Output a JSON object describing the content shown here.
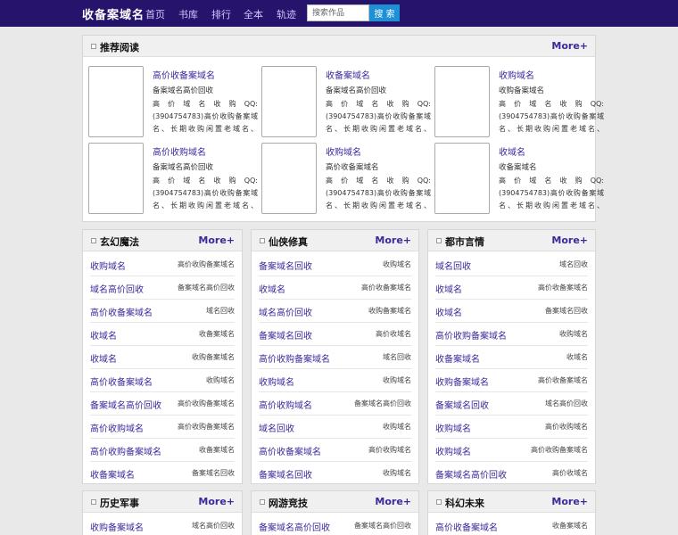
{
  "header": {
    "logo": "收备案域名",
    "nav": [
      "首页",
      "书库",
      "排行",
      "全本",
      "轨迹"
    ],
    "search_placeholder": "搜索作品",
    "search_button": "搜 索"
  },
  "featured": {
    "title": "推荐阅读",
    "more": "More+",
    "items": [
      {
        "title": "高价收备案域名",
        "author": "备案域名高价回收",
        "desc": "高价域名收购QQ:(3904754783)高价收购备案域名、长期收购闲置老域名、"
      },
      {
        "title": "收备案域名",
        "author": "备案域名高价回收",
        "desc": "高价域名收购QQ:(3904754783)高价收购备案域名、长期收购闲置老域名、"
      },
      {
        "title": "收购域名",
        "author": "收购备案域名",
        "desc": "高价域名收购QQ:(3904754783)高价收购备案域名、长期收购闲置老域名、"
      },
      {
        "title": "高价收购域名",
        "author": "备案域名高价回收",
        "desc": "高价域名收购QQ:(3904754783)高价收购备案域名、长期收购闲置老域名、"
      },
      {
        "title": "收购域名",
        "author": "高价收备案域名",
        "desc": "高价域名收购QQ:(3904754783)高价收购备案域名、长期收购闲置老域名、"
      },
      {
        "title": "收域名",
        "author": "收备案域名",
        "desc": "高价域名收购QQ:(3904754783)高价收购备案域名、长期收购闲置老域名、"
      }
    ]
  },
  "categories": [
    {
      "title": "玄幻魔法",
      "more": "More+",
      "rows": [
        {
          "title": "收购域名",
          "author": "高价收购备案域名"
        },
        {
          "title": "域名高价回收",
          "author": "备案域名高价回收"
        },
        {
          "title": "高价收备案域名",
          "author": "域名回收"
        },
        {
          "title": "收域名",
          "author": "收备案域名"
        },
        {
          "title": "收域名",
          "author": "收购备案域名"
        },
        {
          "title": "高价收备案域名",
          "author": "收购域名"
        },
        {
          "title": "备案域名高价回收",
          "author": "高价收购备案域名"
        },
        {
          "title": "高价收购域名",
          "author": "高价收购备案域名"
        },
        {
          "title": "高价收购备案域名",
          "author": "收备案域名"
        },
        {
          "title": "收备案域名",
          "author": "备案域名回收"
        }
      ]
    },
    {
      "title": "仙侠修真",
      "more": "More+",
      "rows": [
        {
          "title": "备案域名回收",
          "author": "收购域名"
        },
        {
          "title": "收域名",
          "author": "高价收备案域名"
        },
        {
          "title": "域名高价回收",
          "author": "收购备案域名"
        },
        {
          "title": "备案域名回收",
          "author": "高价收域名"
        },
        {
          "title": "高价收购备案域名",
          "author": "域名回收"
        },
        {
          "title": "收购域名",
          "author": "收购域名"
        },
        {
          "title": "高价收购域名",
          "author": "备案域名高价回收"
        },
        {
          "title": "域名回收",
          "author": "收购域名"
        },
        {
          "title": "高价收备案域名",
          "author": "高价收购域名"
        },
        {
          "title": "备案域名回收",
          "author": "收购域名"
        }
      ]
    },
    {
      "title": "都市言情",
      "more": "More+",
      "rows": [
        {
          "title": "域名回收",
          "author": "域名回收"
        },
        {
          "title": "收域名",
          "author": "高价收备案域名"
        },
        {
          "title": "收域名",
          "author": "备案域名回收"
        },
        {
          "title": "高价收购备案域名",
          "author": "收购域名"
        },
        {
          "title": "收备案域名",
          "author": "收域名"
        },
        {
          "title": "收购备案域名",
          "author": "高价收备案域名"
        },
        {
          "title": "备案域名回收",
          "author": "域名高价回收"
        },
        {
          "title": "收购域名",
          "author": "高价收购域名"
        },
        {
          "title": "收购域名",
          "author": "高价收购备案域名"
        },
        {
          "title": "备案域名高价回收",
          "author": "高价收域名"
        }
      ]
    },
    {
      "title": "历史军事",
      "more": "More+",
      "rows": [
        {
          "title": "收购备案域名",
          "author": "域名高价回收"
        }
      ]
    },
    {
      "title": "网游竞技",
      "more": "More+",
      "rows": [
        {
          "title": "备案域名高价回收",
          "author": "备案域名高价回收"
        }
      ]
    },
    {
      "title": "科幻未来",
      "more": "More+",
      "rows": [
        {
          "title": "高价收备案域名",
          "author": "收备案域名"
        }
      ]
    }
  ]
}
